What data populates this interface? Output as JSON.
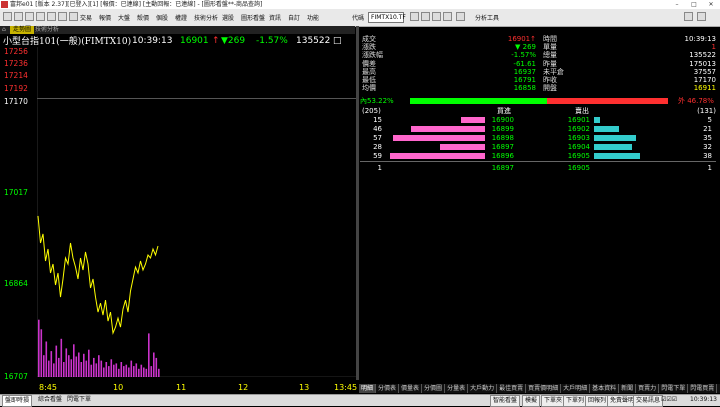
{
  "window": {
    "title": "富邦e01 [版本 2.37][已登入][1] [報價：已連線] [主動回報：已連線] - [圖形看盤**-商品查詢]"
  },
  "menu": {
    "items": [
      "交易",
      "報價",
      "大盤",
      "殼價",
      "個股",
      "權證",
      "技術分析",
      "選股",
      "圖形看盤",
      "資訊",
      "自訂",
      "功能"
    ],
    "code_label": "代碼",
    "code_value": "FIMTX10.TF",
    "tech_label": "分析工具"
  },
  "chart_tabs": {
    "tab1": "走勢圖",
    "tab2": "技術分析"
  },
  "chart_header": {
    "name": "小型台指101(一般)(FIMTX10)",
    "time": "10:39:13",
    "price": "16901",
    "change": "▼269",
    "pct": "-1.57%",
    "volume": "135522"
  },
  "y_axis": {
    "top_labels": [
      "17256",
      "17236",
      "17214",
      "17192"
    ],
    "ref": "17170",
    "mid": "17017",
    "low": "16864",
    "bottom": "16707"
  },
  "x_axis": [
    "8:45",
    "10",
    "11",
    "12",
    "13",
    "13:45"
  ],
  "chart_data": {
    "type": "line",
    "y_range": [
      16707,
      17256
    ],
    "reference": 17170,
    "x_range": [
      "8:45",
      "13:45"
    ],
    "series": [
      {
        "name": "",
        "values": [
          16975,
          16930,
          16945,
          16900,
          16920,
          16880,
          16895,
          16860,
          16880,
          16840,
          16870,
          16905,
          16895,
          16930,
          16905,
          16890,
          16870,
          16905,
          16885,
          16915,
          16895,
          16855,
          16870,
          16840,
          16815,
          16830,
          16810,
          16835,
          16800,
          16815,
          16780,
          16790,
          16805,
          16790,
          16820,
          16835,
          16815,
          16850,
          16870,
          16890,
          16880,
          16900,
          16885,
          16895,
          16910,
          16905,
          16920,
          16910,
          16925
        ]
      },
      {
        "name": "",
        "values": [
          210,
          175,
          80,
          130,
          60,
          95,
          50,
          115,
          70,
          140,
          55,
          105,
          80,
          65,
          120,
          75,
          90,
          55,
          85,
          60,
          100,
          45,
          70,
          50,
          80,
          60,
          35,
          55,
          40,
          65,
          45,
          50,
          30,
          55,
          40,
          45,
          35,
          60,
          40,
          50,
          30,
          45,
          35,
          30,
          160,
          40,
          90,
          70,
          30
        ]
      }
    ]
  },
  "quote": {
    "rows": [
      {
        "l1": "成交",
        "v1": "16901↑",
        "l2": "時間",
        "v2": "10:39:13"
      },
      {
        "l1": "漲跌",
        "v1": "▼ 269",
        "l2": "單量",
        "v2": "1"
      },
      {
        "l1": "漲跌幅",
        "v1": "-1.57%",
        "l2": "總量",
        "v2": "135522"
      },
      {
        "l1": "價差",
        "v1": "-61.61",
        "l2": "昨量",
        "v2": "175013"
      },
      {
        "l1": "最高",
        "v1": "16937",
        "l2": "未平倉",
        "v2": "37557"
      },
      {
        "l1": "最低",
        "v1": "16791",
        "l2": "昨收",
        "v2": "17170"
      },
      {
        "l1": "均價",
        "v1": "16858",
        "l2": "開盤",
        "v2": "16911"
      }
    ],
    "inner_label": "內53.22%",
    "outer_label": "外 46.78%",
    "inner_pct": 53.22,
    "book_header": {
      "bid_count": "(205)",
      "bid": "買進",
      "ask": "賣出",
      "ask_count": "(131)"
    },
    "book": [
      {
        "bq": "15",
        "bp": "16900",
        "ap": "16901",
        "aq": "5"
      },
      {
        "bq": "46",
        "bp": "16899",
        "ap": "16902",
        "aq": "21"
      },
      {
        "bq": "57",
        "bp": "16898",
        "ap": "16903",
        "aq": "35"
      },
      {
        "bq": "28",
        "bp": "16897",
        "ap": "16904",
        "aq": "32"
      },
      {
        "bq": "59",
        "bp": "16896",
        "ap": "16905",
        "aq": "38"
      }
    ],
    "book_total": {
      "bq": "1",
      "bp": "16897",
      "ap": "16905",
      "aq": "1"
    }
  },
  "bottom_tabs": [
    "明細",
    "分價表",
    "價量表",
    "分價圖",
    "分量表",
    "大戶動力",
    "最佳買賣",
    "買賣價明細",
    "大戶明細",
    "基本資料",
    "新聞",
    "買賣力",
    "閃電下單",
    "閃電買賣"
  ],
  "status": {
    "tabs": [
      "盤即時損",
      "綜合看盤",
      "閃電下單"
    ],
    "buttons": [
      "智能看盤",
      "模擬",
      "下單夾",
      "下單列",
      "回報列",
      "免責聲明",
      "交易訊息"
    ],
    "clock": "10:39:13"
  },
  "colors": {
    "up": "#ff3030",
    "down": "#00ff00",
    "price_line": "#ffff00",
    "volume": "#cc33cc",
    "bid_bar": "#ff66cc",
    "ask_bar": "#33cccc"
  }
}
